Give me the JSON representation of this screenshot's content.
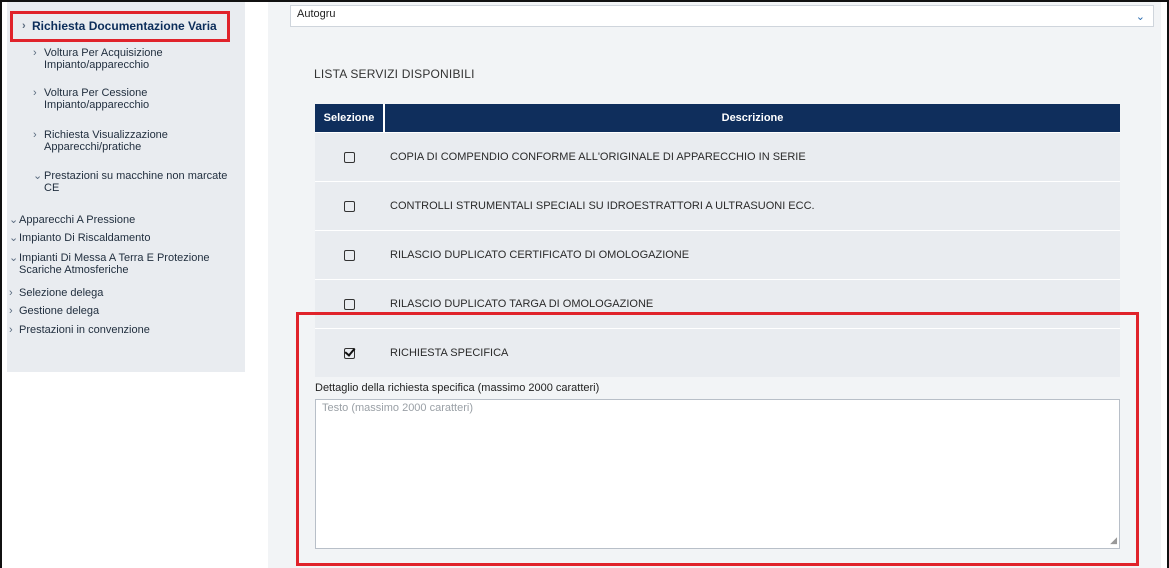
{
  "sidebar": {
    "items": [
      {
        "label": "Richiesta Documentazione Varia"
      },
      {
        "label": "Voltura Per Acquisizione Impianto/apparecchio"
      },
      {
        "label": "Voltura Per Cessione Impianto/apparecchio"
      },
      {
        "label": "Richiesta Visualizzazione Apparecchi/pratiche"
      },
      {
        "label": "Prestazioni su macchine non marcate CE"
      },
      {
        "label": "Apparecchi A Pressione"
      },
      {
        "label": "Impianto Di Riscaldamento"
      },
      {
        "label": "Impianti Di Messa A Terra E Protezione Scariche Atmosferiche"
      },
      {
        "label": "Selezione delega"
      },
      {
        "label": "Gestione delega"
      },
      {
        "label": "Prestazioni in convenzione"
      }
    ]
  },
  "main": {
    "select_value": "Autogru",
    "section_title": "LISTA SERVIZI DISPONIBILI",
    "table": {
      "headers": [
        "Selezione",
        "Descrizione"
      ],
      "rows": [
        {
          "checked": false,
          "description": "COPIA DI COMPENDIO CONFORME ALL'ORIGINALE DI APPARECCHIO IN SERIE"
        },
        {
          "checked": false,
          "description": "CONTROLLI STRUMENTALI SPECIALI SU IDROESTRATTORI A ULTRASUONI ECC."
        },
        {
          "checked": false,
          "description": "RILASCIO DUPLICATO CERTIFICATO DI OMOLOGAZIONE"
        },
        {
          "checked": false,
          "description": "RILASCIO DUPLICATO TARGA DI OMOLOGAZIONE"
        },
        {
          "checked": true,
          "description": "RICHIESTA SPECIFICA"
        }
      ]
    },
    "detail_label": "Dettaglio della richiesta specifica (massimo 2000 caratteri)",
    "detail_placeholder": "Testo (massimo 2000 caratteri)"
  },
  "colors": {
    "highlight": "#e0232b",
    "table_header": "#0f2e5c",
    "sidebar_bg": "#e9ecf0"
  }
}
